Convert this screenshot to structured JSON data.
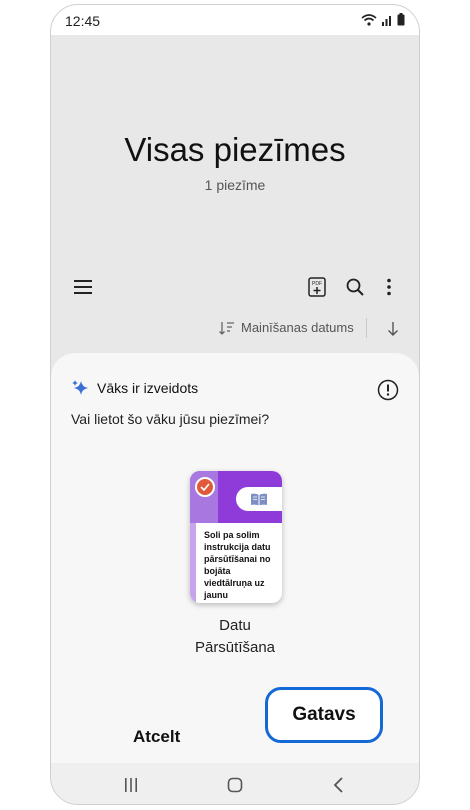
{
  "status_bar": {
    "time": "12:45"
  },
  "header": {
    "title": "Visas piezīmes",
    "note_count": "1 piezīme"
  },
  "toolbar": {
    "menu_icon": "hamburger-menu-icon",
    "pdf_icon": "pdf-add-icon",
    "search_icon": "search-icon",
    "more_icon": "more-vertical-icon"
  },
  "sort": {
    "label": "Mainīšanas datums"
  },
  "sheet": {
    "title": "Vāks ir izveidots",
    "question": "Vai lietot šo vāku jūsu piezīmei?",
    "cover": {
      "description": "Soli pa solim instrukcija datu pārsūtīšanai no bojāta viedtālruņa uz jaunu viedtālruņu",
      "name_line1": "Datu",
      "name_line2": "Pārsūtīšana"
    },
    "cancel_label": "Atcelt",
    "done_label": "Gatavs"
  },
  "colors": {
    "accent": "#1569d6",
    "cover_purple": "#8f3bd9",
    "check_red": "#e05a3a"
  }
}
